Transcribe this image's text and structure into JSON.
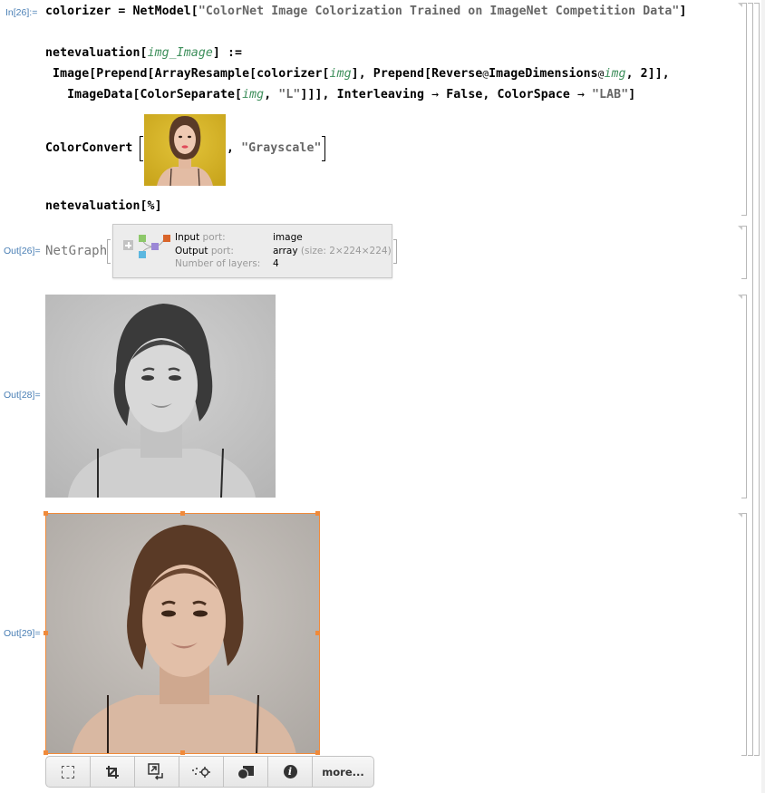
{
  "cells": {
    "in26": {
      "label": "In[26]:=",
      "line1": {
        "lhs": "colorizer",
        "eq": " = ",
        "fn": "NetModel[",
        "str": "\"ColorNet Image Colorization Trained on ImageNet Competition Data\"",
        "close": "]"
      },
      "line2": {
        "fn": "netevaluation[",
        "var": "img_Image",
        "rest": "] :="
      },
      "line3": {
        "a": " Image[Prepend[ArrayResample[colorizer[",
        "var1": "img",
        "b": "], Prepend[Reverse",
        "at1": "@",
        "c": "ImageDimensions",
        "at2": "@",
        "var2": "img",
        "d": ", 2]],"
      },
      "line4": {
        "a": "   ImageData[ColorSeparate[",
        "var1": "img",
        "b": ", ",
        "str": "\"L\"",
        "c": "]]], Interleaving ",
        "arr1": "→",
        "d": " False, ColorSpace ",
        "arr2": "→",
        "e": " ",
        "str2": "\"LAB\"",
        "f": "]"
      },
      "line5": {
        "fn": "ColorConvert",
        "sep": ", ",
        "str": "\"Grayscale\""
      },
      "line6": {
        "text": "netevaluation[%]"
      }
    },
    "out26": {
      "label": "Out[26]=",
      "head": "NetGraph",
      "summary": {
        "input_key": "Input",
        "input_suffix": " port:",
        "input_value": "image",
        "output_key": "Output",
        "output_suffix": " port:",
        "output_value": "array",
        "output_size": " (size: 2×224×224)",
        "layers_key": "Number of layers:",
        "layers_value": "4",
        "expand_icon": "plus-icon",
        "graph_colors": [
          "#8dc86a",
          "#5bb7e0",
          "#9b87d6",
          "#d9652a"
        ]
      }
    },
    "out28": {
      "label": "Out[28]=",
      "image": "grayscale-portrait"
    },
    "out29": {
      "label": "Out[29]=",
      "image": "colorized-portrait",
      "selection_color": "#f08a3a"
    }
  },
  "toolbar": {
    "buttons": [
      {
        "name": "select-icon",
        "title": ""
      },
      {
        "name": "crop-icon",
        "title": ""
      },
      {
        "name": "resize-icon",
        "title": ""
      },
      {
        "name": "coordinates-icon",
        "title": ""
      },
      {
        "name": "mask-icon",
        "title": ""
      },
      {
        "name": "info-icon",
        "title": ""
      }
    ],
    "more_label": "more..."
  },
  "colors": {
    "label_blue": "#4a7fb5",
    "string_gray": "#666666",
    "var_green": "#3c8e5a",
    "thumb_yellow": "#d7b625"
  }
}
